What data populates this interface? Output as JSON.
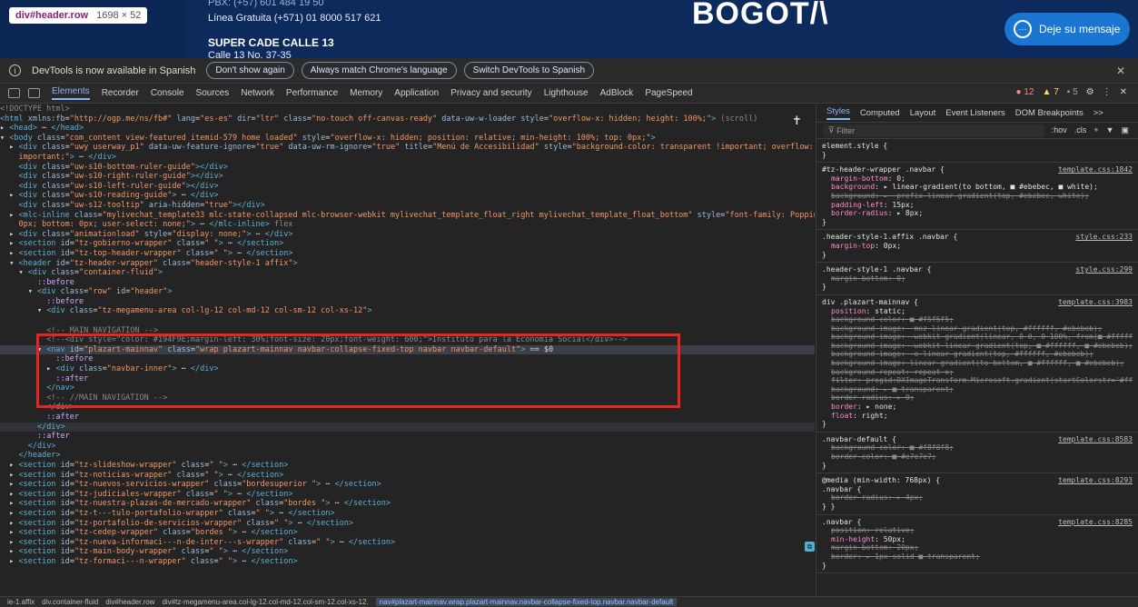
{
  "site_header": {
    "badge_tag": "div#header.row",
    "badge_dims": "1698 × 52",
    "pbx": "PBX: (+57) 601 484 19 50",
    "linea": "Línea Gratuita (+571) 01 8000 517 621",
    "cade": "SUPER CADE CALLE 13",
    "calle": "Calle 13 No. 37-35",
    "logo": "BOGOT/\\",
    "deje_label": "Deje su mensaje"
  },
  "infobar": {
    "text": "DevTools is now available in Spanish",
    "btn_dont_show": "Don't show again",
    "btn_always_match": "Always match Chrome's language",
    "btn_switch": "Switch DevTools to Spanish"
  },
  "devtools_tabs": [
    "Elements",
    "Recorder",
    "Console",
    "Sources",
    "Network",
    "Performance",
    "Memory",
    "Application",
    "Privacy and security",
    "Lighthouse",
    "AdBlock",
    "PageSpeed"
  ],
  "status": {
    "errors": "12",
    "warnings": "7",
    "messages": "5"
  },
  "dom_lines": [
    {
      "html": "<span class='c'>&lt;!DOCTYPE html&gt;</span>"
    },
    {
      "html": "<span class='t'>&lt;html</span> <span class='a'>xmlns:fb</span>=<span class='v'>\"http://ogp.me/ns/fb#\"</span> <span class='a'>lang</span>=<span class='v'>\"es-es\"</span> <span class='a'>dir</span>=<span class='v'>\"ltr\"</span> <span class='a'>class</span>=<span class='v'>\"no-touch off-canvas-ready\"</span> <span class='a'>data-uw-w-loader</span> <span class='a'>style</span>=<span class='v'>\"overflow-x: hidden; height: 100%;\"</span><span class='t'>&gt;</span> <span class='c'>(scroll)</span>"
    },
    {
      "html": "▸ <span class='t'>&lt;head&gt;</span> ⋯ <span class='t'>&lt;/head&gt;</span>"
    },
    {
      "html": "▾ <span class='t'>&lt;body</span> <span class='a'>class</span>=<span class='v'>\"com_content view-featured itemid-579 home loaded\"</span> <span class='a'>style</span>=<span class='v'>\"overflow-x: hidden; position: relative; min-height: 100%; top: 0px;\"</span><span class='t'>&gt;</span>"
    },
    {
      "html": "&nbsp;&nbsp;▸ <span class='t'>&lt;div</span> <span class='a'>class</span>=<span class='v'>\"uwy userway_p1\"</span> <span class='a'>data-uw-feature-ignore</span>=<span class='v'>\"true\"</span> <span class='a'>data-uw-rm-ignore</span>=<span class='v'>\"true\"</span> <span class='a'>title</span>=<span class='v'>\"Menú de Accesibilidad\"</span> <span class='a'>style</span>=<span class='v'>\"background-color: transparent !important; overflow: initial !</span>"
    },
    {
      "html": "&nbsp;&nbsp;&nbsp;&nbsp;<span class='v'>important;\"</span><span class='t'>&gt;</span> ⋯ <span class='t'>&lt;/div&gt;</span>"
    },
    {
      "html": "&nbsp;&nbsp;&nbsp;&nbsp;<span class='t'>&lt;div</span> <span class='a'>class</span>=<span class='v'>\"uw-s10-bottom-ruler-guide\"</span><span class='t'>&gt;&lt;/div&gt;</span>"
    },
    {
      "html": "&nbsp;&nbsp;&nbsp;&nbsp;<span class='t'>&lt;div</span> <span class='a'>class</span>=<span class='v'>\"uw-s10-right-ruler-guide\"</span><span class='t'>&gt;&lt;/div&gt;</span>"
    },
    {
      "html": "&nbsp;&nbsp;&nbsp;&nbsp;<span class='t'>&lt;div</span> <span class='a'>class</span>=<span class='v'>\"uw-s10-left-ruler-guide\"</span><span class='t'>&gt;&lt;/div&gt;</span>"
    },
    {
      "html": "&nbsp;&nbsp;▸ <span class='t'>&lt;div</span> <span class='a'>class</span>=<span class='v'>\"uw-s10-reading-guide\"</span><span class='t'>&gt;</span> ⋯ <span class='t'>&lt;/div&gt;</span>"
    },
    {
      "html": "&nbsp;&nbsp;&nbsp;&nbsp;<span class='t'>&lt;div</span> <span class='a'>class</span>=<span class='v'>\"uw-s12-tooltip\"</span> <span class='a'>aria-hidden</span>=<span class='v'>\"true\"</span><span class='t'>&gt;&lt;/div&gt;</span>"
    },
    {
      "html": "&nbsp;&nbsp;▸ <span class='t'>&lt;mlc-inline</span> <span class='a'>class</span>=<span class='v'>\"mylivechat_template33 mlc-state-collapsed mlc-browser-webkit mylivechat_template_float_right mylivechat_template_float_bottom\"</span> <span class='a'>style</span>=<span class='v'>\"font-family: Poppins; right: </span>"
    },
    {
      "html": "&nbsp;&nbsp;&nbsp;&nbsp;<span class='v'>0px; bottom: 0px; user-select: none;\"</span><span class='t'>&gt;</span> ⋯ <span class='t'>&lt;/mlc-inline&gt;</span> <span class='c'>flex</span>"
    },
    {
      "html": "&nbsp;&nbsp;▸ <span class='t'>&lt;div</span> <span class='a'>class</span>=<span class='v'>\"animationload\"</span> <span class='a'>style</span>=<span class='v'>\"display: none;\"</span><span class='t'>&gt;</span> ⋯ <span class='t'>&lt;/div&gt;</span>"
    },
    {
      "html": "&nbsp;&nbsp;▸ <span class='t'>&lt;section</span> <span class='a'>id</span>=<span class='v'>\"tz-gobierno-wrapper\"</span> <span class='a'>class</span>=<span class='v'>\" \"</span><span class='t'>&gt;</span> ⋯ <span class='t'>&lt;/section&gt;</span>"
    },
    {
      "html": "&nbsp;&nbsp;▸ <span class='t'>&lt;section</span> <span class='a'>id</span>=<span class='v'>\"tz-top-header-wrapper\"</span> <span class='a'>class</span>=<span class='v'>\" \"</span><span class='t'>&gt;</span> ⋯ <span class='t'>&lt;/section&gt;</span>"
    },
    {
      "html": "&nbsp;&nbsp;▾ <span class='t'>&lt;header</span> <span class='a'>id</span>=<span class='v'>\"tz-header-wrapper\"</span> <span class='a'>class</span>=<span class='v'>\"header-style-1 affix\"</span><span class='t'>&gt;</span>"
    },
    {
      "html": "&nbsp;&nbsp;&nbsp;&nbsp;▾ <span class='t'>&lt;div</span> <span class='a'>class</span>=<span class='v'>\"container-fluid\"</span><span class='t'>&gt;</span>"
    },
    {
      "html": "&nbsp;&nbsp;&nbsp;&nbsp;&nbsp;&nbsp;&nbsp;&nbsp;<span class='pe'>::before</span>"
    },
    {
      "html": "&nbsp;&nbsp;&nbsp;&nbsp;&nbsp;&nbsp;▾ <span class='t'>&lt;div</span> <span class='a'>class</span>=<span class='v'>\"row\"</span> <span class='a'>id</span>=<span class='v'>\"header\"</span><span class='t'>&gt;</span>"
    },
    {
      "html": "&nbsp;&nbsp;&nbsp;&nbsp;&nbsp;&nbsp;&nbsp;&nbsp;&nbsp;&nbsp;<span class='pe'>::before</span>"
    },
    {
      "html": "&nbsp;&nbsp;&nbsp;&nbsp;&nbsp;&nbsp;&nbsp;&nbsp;▾ <span class='t'>&lt;div</span> <span class='a'>class</span>=<span class='v'>\"tz-megamenu-area col-lg-12 col-md-12 col-sm-12 col-xs-12\"</span><span class='t'>&gt;</span>"
    },
    {
      "html": "",
      "spacer": true
    },
    {
      "html": "&nbsp;&nbsp;&nbsp;&nbsp;&nbsp;&nbsp;&nbsp;&nbsp;&nbsp;&nbsp;<span class='c'>&lt;!-- MAIN NAVIGATION --&gt;</span>"
    },
    {
      "html": "&nbsp;&nbsp;&nbsp;&nbsp;&nbsp;&nbsp;&nbsp;&nbsp;&nbsp;&nbsp;<span class='c'>&lt;!--&lt;div style=\"color: #194F9E;margin-left: 30%;font-size: 20px;font-weight: 600;\"&gt;Instituto para la Economía Social&lt;/div&gt;--&gt;</span>"
    },
    {
      "html": "&nbsp;&nbsp;&nbsp;&nbsp;&nbsp;&nbsp;&nbsp;&nbsp;▾ <span class='t'>&lt;nav</span> <span class='a'>id</span>=<span class='v'>\"plazart-mainnav\"</span> <span class='a'>class</span>=<span class='v'>\"wrap plazart-mainnav navbar-collapse-fixed-top navbar navbar-default\"</span><span class='t'>&gt;</span> == $0",
      "sel": true
    },
    {
      "html": "&nbsp;&nbsp;&nbsp;&nbsp;&nbsp;&nbsp;&nbsp;&nbsp;&nbsp;&nbsp;&nbsp;&nbsp;<span class='pe'>::before</span>"
    },
    {
      "html": "&nbsp;&nbsp;&nbsp;&nbsp;&nbsp;&nbsp;&nbsp;&nbsp;&nbsp;&nbsp;▸ <span class='t'>&lt;div</span> <span class='a'>class</span>=<span class='v'>\"navbar-inner\"</span><span class='t'>&gt;</span> ⋯ <span class='t'>&lt;/div&gt;</span>"
    },
    {
      "html": "&nbsp;&nbsp;&nbsp;&nbsp;&nbsp;&nbsp;&nbsp;&nbsp;&nbsp;&nbsp;&nbsp;&nbsp;<span class='pe'>::after</span>"
    },
    {
      "html": "&nbsp;&nbsp;&nbsp;&nbsp;&nbsp;&nbsp;&nbsp;&nbsp;&nbsp;&nbsp;<span class='t'>&lt;/nav&gt;</span>"
    },
    {
      "html": "&nbsp;&nbsp;&nbsp;&nbsp;&nbsp;&nbsp;&nbsp;&nbsp;&nbsp;&nbsp;<span class='c'>&lt;!-- //MAIN NAVIGATION --&gt;</span>"
    },
    {
      "html": "&nbsp;&nbsp;&nbsp;&nbsp;&nbsp;&nbsp;&nbsp;&nbsp;&nbsp;&nbsp;<span class='t'>&lt;/div&gt;</span>"
    },
    {
      "html": "&nbsp;&nbsp;&nbsp;&nbsp;&nbsp;&nbsp;&nbsp;&nbsp;&nbsp;&nbsp;<span class='pe'>::after</span>"
    },
    {
      "html": "&nbsp;&nbsp;&nbsp;&nbsp;&nbsp;&nbsp;&nbsp;&nbsp;<span class='t'>&lt;/div&gt;</span>",
      "hov": true
    },
    {
      "html": "&nbsp;&nbsp;&nbsp;&nbsp;&nbsp;&nbsp;&nbsp;&nbsp;<span class='pe'>::after</span>"
    },
    {
      "html": "&nbsp;&nbsp;&nbsp;&nbsp;&nbsp;&nbsp;<span class='t'>&lt;/div&gt;</span>"
    },
    {
      "html": "&nbsp;&nbsp;&nbsp;&nbsp;<span class='t'>&lt;/header&gt;</span>"
    },
    {
      "html": "&nbsp;&nbsp;▸ <span class='t'>&lt;section</span> <span class='a'>id</span>=<span class='v'>\"tz-slideshow-wrapper\"</span> <span class='a'>class</span>=<span class='v'>\" \"</span><span class='t'>&gt;</span> ⋯ <span class='t'>&lt;/section&gt;</span>"
    },
    {
      "html": "&nbsp;&nbsp;▸ <span class='t'>&lt;section</span> <span class='a'>id</span>=<span class='v'>\"tz-noticias-wrapper\"</span> <span class='a'>class</span>=<span class='v'>\" \"</span><span class='t'>&gt;</span> ⋯ <span class='t'>&lt;/section&gt;</span>"
    },
    {
      "html": "&nbsp;&nbsp;▸ <span class='t'>&lt;section</span> <span class='a'>id</span>=<span class='v'>\"tz-nuevos-servicios-wrapper\"</span> <span class='a'>class</span>=<span class='v'>\"bordesuperior \"</span><span class='t'>&gt;</span> ⋯ <span class='t'>&lt;/section&gt;</span>"
    },
    {
      "html": "&nbsp;&nbsp;▸ <span class='t'>&lt;section</span> <span class='a'>id</span>=<span class='v'>\"tz-judiciales-wrapper\"</span> <span class='a'>class</span>=<span class='v'>\" \"</span><span class='t'>&gt;</span> ⋯ <span class='t'>&lt;/section&gt;</span>"
    },
    {
      "html": "&nbsp;&nbsp;▸ <span class='t'>&lt;section</span> <span class='a'>id</span>=<span class='v'>\"tz-nuestra-plazas-de-mercado-wrapper\"</span> <span class='a'>class</span>=<span class='v'>\"bordes \"</span><span class='t'>&gt;</span> ⋯ <span class='t'>&lt;/section&gt;</span>"
    },
    {
      "html": "&nbsp;&nbsp;▸ <span class='t'>&lt;section</span> <span class='a'>id</span>=<span class='v'>\"tz-t---tulo-portafolio-wrapper\"</span> <span class='a'>class</span>=<span class='v'>\" \"</span><span class='t'>&gt;</span> ⋯ <span class='t'>&lt;/section&gt;</span>"
    },
    {
      "html": "&nbsp;&nbsp;▸ <span class='t'>&lt;section</span> <span class='a'>id</span>=<span class='v'>\"tz-portafolio-de-servicios-wrapper\"</span> <span class='a'>class</span>=<span class='v'>\" \"</span><span class='t'>&gt;</span> ⋯ <span class='t'>&lt;/section&gt;</span>"
    },
    {
      "html": "&nbsp;&nbsp;▸ <span class='t'>&lt;section</span> <span class='a'>id</span>=<span class='v'>\"tz-cedep-wrapper\"</span> <span class='a'>class</span>=<span class='v'>\"bordes \"</span><span class='t'>&gt;</span> ⋯ <span class='t'>&lt;/section&gt;</span>"
    },
    {
      "html": "&nbsp;&nbsp;▸ <span class='t'>&lt;section</span> <span class='a'>id</span>=<span class='v'>\"tz-nueva-informaci---n-de-inter---s-wrapper\"</span> <span class='a'>class</span>=<span class='v'>\" \"</span><span class='t'>&gt;</span> ⋯ <span class='t'>&lt;/section&gt;</span>"
    },
    {
      "html": "&nbsp;&nbsp;▸ <span class='t'>&lt;section</span> <span class='a'>id</span>=<span class='v'>\"tz-main-body-wrapper\"</span> <span class='a'>class</span>=<span class='v'>\" \"</span><span class='t'>&gt;</span> ⋯ <span class='t'>&lt;/section&gt;</span>"
    },
    {
      "html": "&nbsp;&nbsp;▸ <span class='t'>&lt;section</span> <span class='a'>id</span>=<span class='v'>\"tz-formaci---n-wrapper\"</span> <span class='a'>class</span>=<span class='v'>\" \"</span><span class='t'>&gt;</span> ⋯ <span class='t'>&lt;/section&gt;</span>"
    }
  ],
  "breadcrumbs": [
    {
      "text": "ie-1.affix"
    },
    {
      "text": "div.container-fluid"
    },
    {
      "text": "div#header.row"
    },
    {
      "text": "div#tz-megamenu-area.col-lg-12.col-md-12.col-sm-12.col-xs-12."
    },
    {
      "text": "nav#plazart-mainnav.wrap.plazart-mainnav.navbar-collapse-fixed-top.navbar.navbar-default",
      "active": true
    }
  ],
  "styles_tabs": [
    "Styles",
    "Computed",
    "Layout",
    "Event Listeners",
    "DOM Breakpoints",
    ">>"
  ],
  "styles_filter": {
    "placeholder": "Filter",
    "hov": ":hov",
    "cls": ".cls"
  },
  "rules": [
    {
      "selector": "element.style {",
      "source": "",
      "decls": []
    },
    {
      "selector": "#tz-header-wrapper .navbar {",
      "source": "template.css:1842",
      "decls": [
        {
          "p": "margin-bottom",
          "v": "0;"
        },
        {
          "p": "background",
          "v": "▸ linear-gradient(to bottom, ■ #ebebec, ■ white);"
        },
        {
          "p": "background",
          "v": "▸ -prefix-linear-gradient(top, #ebebec, white);",
          "strike": true
        },
        {
          "p": "padding-left",
          "v": "15px;"
        },
        {
          "p": "border-radius",
          "v": "▸ 8px;"
        }
      ]
    },
    {
      "selector": ".header-style-1.affix .navbar {",
      "source": "style.css:233",
      "decls": [
        {
          "p": "margin-top",
          "v": "0px;"
        }
      ]
    },
    {
      "selector": ".header-style-1 .navbar {",
      "source": "style.css:299",
      "decls": [
        {
          "p": "margin-bottom",
          "v": "0;",
          "strike": true
        }
      ]
    },
    {
      "selector": "div .plazart-mainnav {",
      "source": "template.css:3983",
      "decls": [
        {
          "p": "position",
          "v": "static;"
        },
        {
          "p": "background-color",
          "v": "■ #f5f5f5;",
          "strike": true
        },
        {
          "p": "background-image",
          "v": "-moz-linear-gradient(top, #ffffff, #ebebeb);",
          "strike": true
        },
        {
          "p": "background-image",
          "v": "-webkit-gradient(linear, 0 0, 0 100%, from(■ #ffffff), to(■ #ebebeb));",
          "strike": true
        },
        {
          "p": "background-image",
          "v": "-webkit-linear-gradient(top, ■ #ffffff, ■ #ebebeb);",
          "strike": true
        },
        {
          "p": "background-image",
          "v": "-o-linear-gradient(top, #ffffff, #ebebeb);",
          "strike": true
        },
        {
          "p": "background-image",
          "v": "linear-gradient(to bottom, ■ #ffffff, ■ #ebebeb);",
          "strike": true
        },
        {
          "p": "background-repeat",
          "v": "repeat-x;",
          "strike": true
        },
        {
          "p": "filter",
          "v": "progid:DXImageTransform.Microsoft.gradient(startColorstr='#ffffffff', endColorstr='#ffebebeb', GradientType=0);",
          "strike": true
        },
        {
          "p": "background",
          "v": "▸ ■ transparent;",
          "strike": true
        },
        {
          "p": "border-radius",
          "v": "▸ 0;",
          "strike": true
        },
        {
          "p": "border",
          "v": "▸ none;"
        },
        {
          "p": "float",
          "v": "right;"
        }
      ]
    },
    {
      "selector": ".navbar-default {",
      "source": "template.css:8583",
      "decls": [
        {
          "p": "background-color",
          "v": "■ #f8f8f8;",
          "strike": true
        },
        {
          "p": "border-color",
          "v": "■ #e7e7e7;",
          "strike": true
        }
      ]
    },
    {
      "selector": "@media (min-width: 768px) {\n.navbar {",
      "source": "template.css:8293",
      "decls": [
        {
          "p": "border-radius",
          "v": "▸ 4px;",
          "strike": true
        }
      ]
    },
    {
      "selector": ".navbar {",
      "source": "template.css:8285",
      "decls": [
        {
          "p": "position",
          "v": "relative;",
          "strike": true
        },
        {
          "p": "min-height",
          "v": "50px;"
        },
        {
          "p": "margin-bottom",
          "v": "20px;",
          "strike": true
        },
        {
          "p": "border",
          "v": "▸ 1px solid ■ transparent;",
          "strike": true
        }
      ]
    }
  ]
}
